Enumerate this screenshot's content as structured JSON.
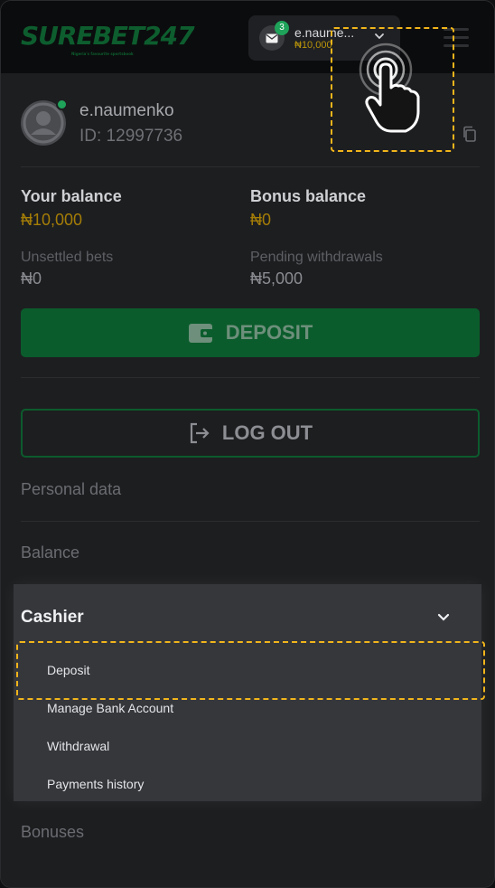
{
  "header": {
    "logo_text": "SUREBET247",
    "logo_tagline": "Nigeria's favourite sportsbook",
    "mail_badge_count": "3",
    "pill_username": "e.naume...",
    "pill_balance": "₦10,000"
  },
  "profile": {
    "username": "e.naumenko",
    "user_id": "ID: 12997736"
  },
  "balances": {
    "your_balance_label": "Your balance",
    "your_balance_value": "₦10,000",
    "bonus_balance_label": "Bonus balance",
    "bonus_balance_value": "₦0",
    "unsettled_label": "Unsettled bets",
    "unsettled_value": "₦0",
    "pending_label": "Pending withdrawals",
    "pending_value": "₦5,000"
  },
  "buttons": {
    "deposit": "DEPOSIT",
    "logout": "LOG OUT"
  },
  "menu": {
    "personal_data": "Personal data",
    "balance": "Balance",
    "cashier": "Cashier",
    "cashier_items": [
      "Deposit",
      "Manage Bank Account",
      "Withdrawal",
      "Payments history"
    ],
    "bonuses": "Bonuses"
  },
  "colors": {
    "brand_green": "#0b5c2c",
    "highlight": "#f2b51b",
    "balance_gold": "#a47d07"
  }
}
